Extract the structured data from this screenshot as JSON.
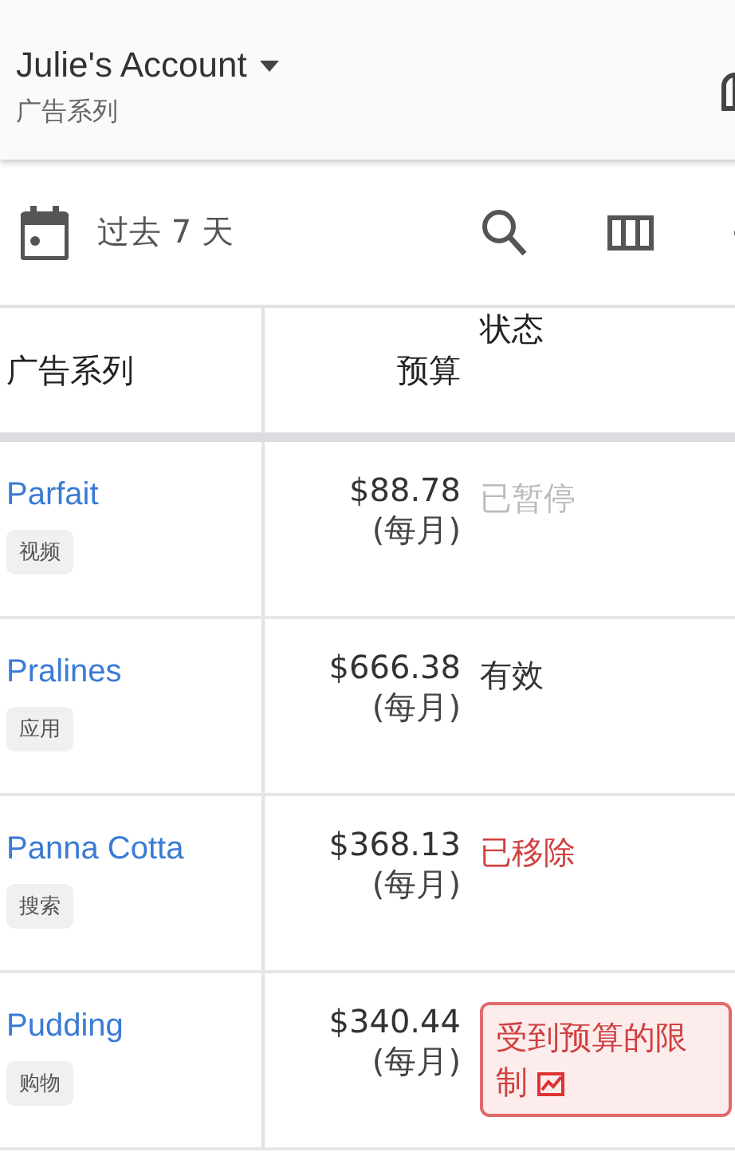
{
  "header": {
    "title": "Julie's Account",
    "subtitle": "广告系列"
  },
  "toolbar": {
    "date_range": "过去 7 天"
  },
  "table": {
    "columns": [
      "广告系列",
      "预算",
      "状态"
    ],
    "rows": [
      {
        "name": "Parfait",
        "tag": "视频",
        "budget": "$88.78",
        "period": "(每月)",
        "status": "已暂停",
        "kind": "paused"
      },
      {
        "name": "Pralines",
        "tag": "应用",
        "budget": "$666.38",
        "period": "(每月)",
        "status": "有效",
        "kind": "enabled"
      },
      {
        "name": "Panna Cotta",
        "tag": "搜索",
        "budget": "$368.13",
        "period": "(每月)",
        "status": "已移除",
        "kind": "removed"
      },
      {
        "name": "Pudding",
        "tag": "购物",
        "budget": "$340.44",
        "period": "(每月)",
        "status": "受到预算的限制",
        "kind": "limited"
      }
    ]
  }
}
